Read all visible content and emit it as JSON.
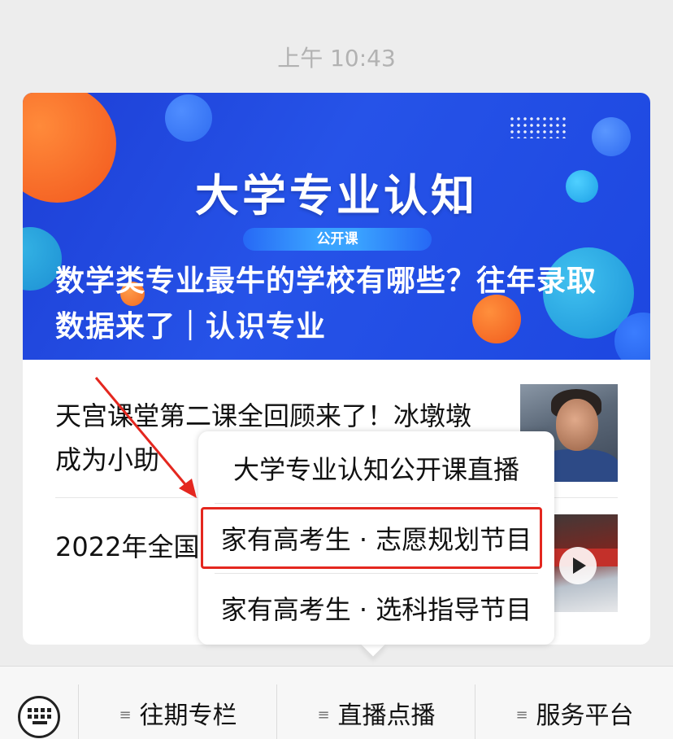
{
  "timestamp": "上午 10:43",
  "banner": {
    "title": "大学专业认知",
    "badge": "公开课",
    "subtitle": "数学类专业最牛的学校有哪些？往年录取数据来了｜认识专业"
  },
  "articles": [
    {
      "title": "天宫课堂第二课全回顾来了！冰墩墩成为小助",
      "thumb_type": "photo"
    },
    {
      "title": "2022年全国热军营 精彩",
      "thumb_type": "video"
    }
  ],
  "popup_menu": {
    "items": [
      {
        "label": "大学专业认知公开课直播"
      },
      {
        "label": "家有高考生 · 志愿规划节目",
        "highlighted": true
      },
      {
        "label": "家有高考生 · 选科指导节目"
      }
    ],
    "highlight_color": "#e4271f"
  },
  "bottom_menu": {
    "keyboard_icon": "keyboard-icon",
    "tabs": [
      {
        "label": "往期专栏",
        "icon": "menu-lines-icon"
      },
      {
        "label": "直播点播",
        "icon": "menu-lines-icon"
      },
      {
        "label": "服务平台",
        "icon": "menu-lines-icon"
      }
    ]
  },
  "colors": {
    "banner_blue": "#1d47e0",
    "annotation_red": "#e4271f",
    "background": "#ededed"
  }
}
